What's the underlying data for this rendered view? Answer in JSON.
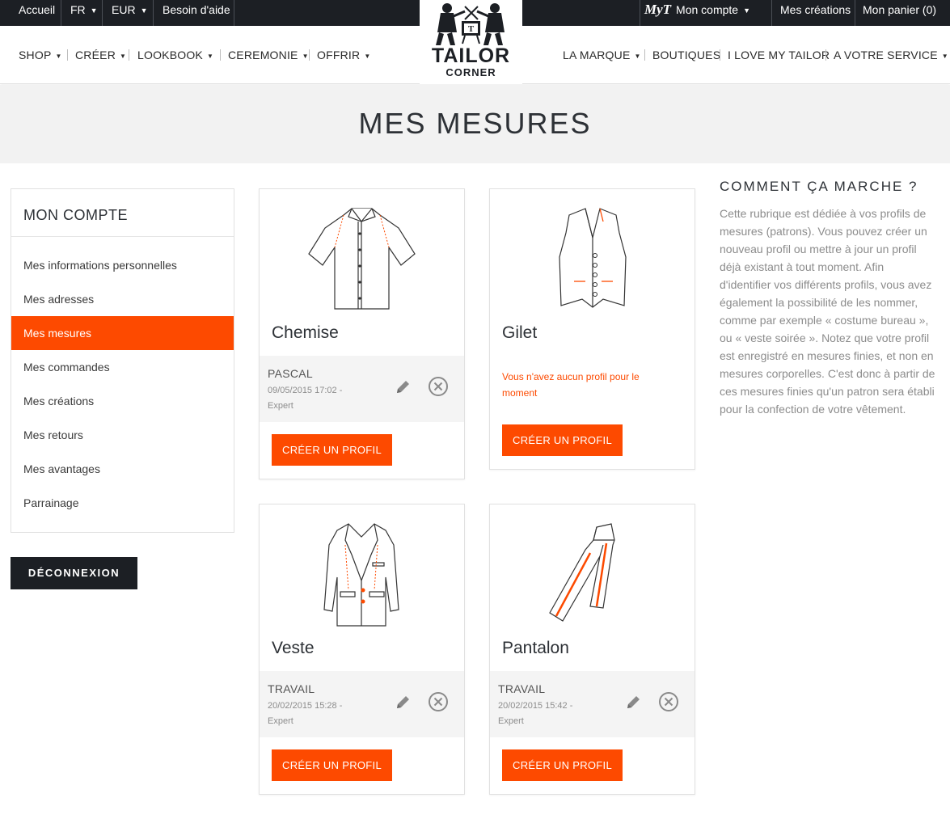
{
  "topbar": {
    "home": "Accueil",
    "lang": "FR",
    "currency": "EUR",
    "help": "Besoin d'aide",
    "myt_logo": "MyT",
    "account": "Mon compte",
    "creations": "Mes créations",
    "cart": "Mon panier (0)"
  },
  "logo": {
    "line1": "TAILOR",
    "line2": "CORNER"
  },
  "nav": {
    "left": [
      "SHOP",
      "CRÉER",
      "LOOKBOOK",
      "CEREMONIE",
      "OFFRIR"
    ],
    "right": [
      "LA MARQUE",
      "BOUTIQUES",
      "I LOVE MY TAILOR",
      "A VOTRE SERVICE"
    ]
  },
  "page": {
    "title": "MES MESURES"
  },
  "sidebar": {
    "title": "MON COMPTE",
    "items": [
      "Mes informations personnelles",
      "Mes adresses",
      "Mes mesures",
      "Mes commandes",
      "Mes créations",
      "Mes retours",
      "Mes avantages",
      "Parrainage"
    ],
    "active": "Mes mesures",
    "logout": "DÉCONNEXION"
  },
  "cards": [
    {
      "title": "Chemise",
      "icon": "shirt-icon",
      "profile": {
        "name": "PASCAL",
        "date": "09/05/2015 17:02 -",
        "level": "Expert"
      },
      "button": "CRÉER UN PROFIL"
    },
    {
      "title": "Gilet",
      "icon": "waistcoat-icon",
      "empty_message": "Vous n'avez aucun profil pour le moment",
      "button": "CRÉER UN PROFIL"
    },
    {
      "title": "Veste",
      "icon": "jacket-icon",
      "profile": {
        "name": "TRAVAIL",
        "date": "20/02/2015 15:28 -",
        "level": "Expert"
      },
      "button": "CRÉER UN PROFIL"
    },
    {
      "title": "Pantalon",
      "icon": "trousers-icon",
      "profile": {
        "name": "TRAVAIL",
        "date": "20/02/2015 15:42 -",
        "level": "Expert"
      },
      "button": "CRÉER UN PROFIL"
    }
  ],
  "info": {
    "title": "COMMENT ÇA MARCHE ?",
    "text": "Cette rubrique est dédiée à vos profils de mesures (patrons). Vous pouvez créer un nouveau profil ou mettre à jour un profil déjà existant à tout moment. Afin d'identifier vos différents profils, vous avez également la possibilité de les nommer, comme par exemple « costume bureau », ou « veste soirée ». Notez que votre profil est enregistré en mesures finies, et non en mesures corporelles. C'est donc à partir de ces mesures finies qu'un patron sera établi pour la confection de votre vêtement."
  },
  "colors": {
    "accent": "#fd4a00",
    "dark": "#1c1f24",
    "hero_bg": "#f2f2f2",
    "muted_text": "#8c8c8c"
  }
}
